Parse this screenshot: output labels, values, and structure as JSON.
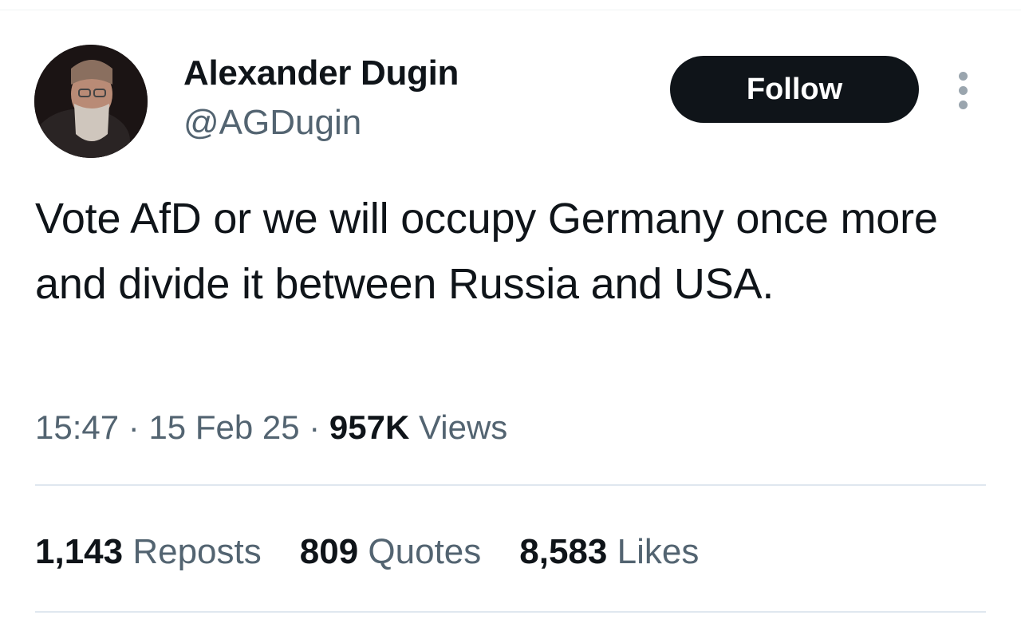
{
  "author": {
    "name": "Alexander Dugin",
    "handle": "@AGDugin"
  },
  "follow_label": "Follow",
  "tweet": {
    "text": "Vote AfD or we will occupy Germany once more and divide it between Russia and USA."
  },
  "meta": {
    "time": "15:47",
    "separator": " · ",
    "date": "15 Feb 25",
    "views_count": "957K",
    "views_label": " Views"
  },
  "stats": {
    "reposts_count": "1,143",
    "reposts_label": " Reposts",
    "quotes_count": "809",
    "quotes_label": " Quotes",
    "likes_count": "8,583",
    "likes_label": " Likes"
  },
  "icons": {
    "more": "more-vertical-icon"
  },
  "colors": {
    "primary_text": "#0f1419",
    "secondary_text": "#536471",
    "button_bg": "#0f1419",
    "divider": "#dfe7ef"
  }
}
